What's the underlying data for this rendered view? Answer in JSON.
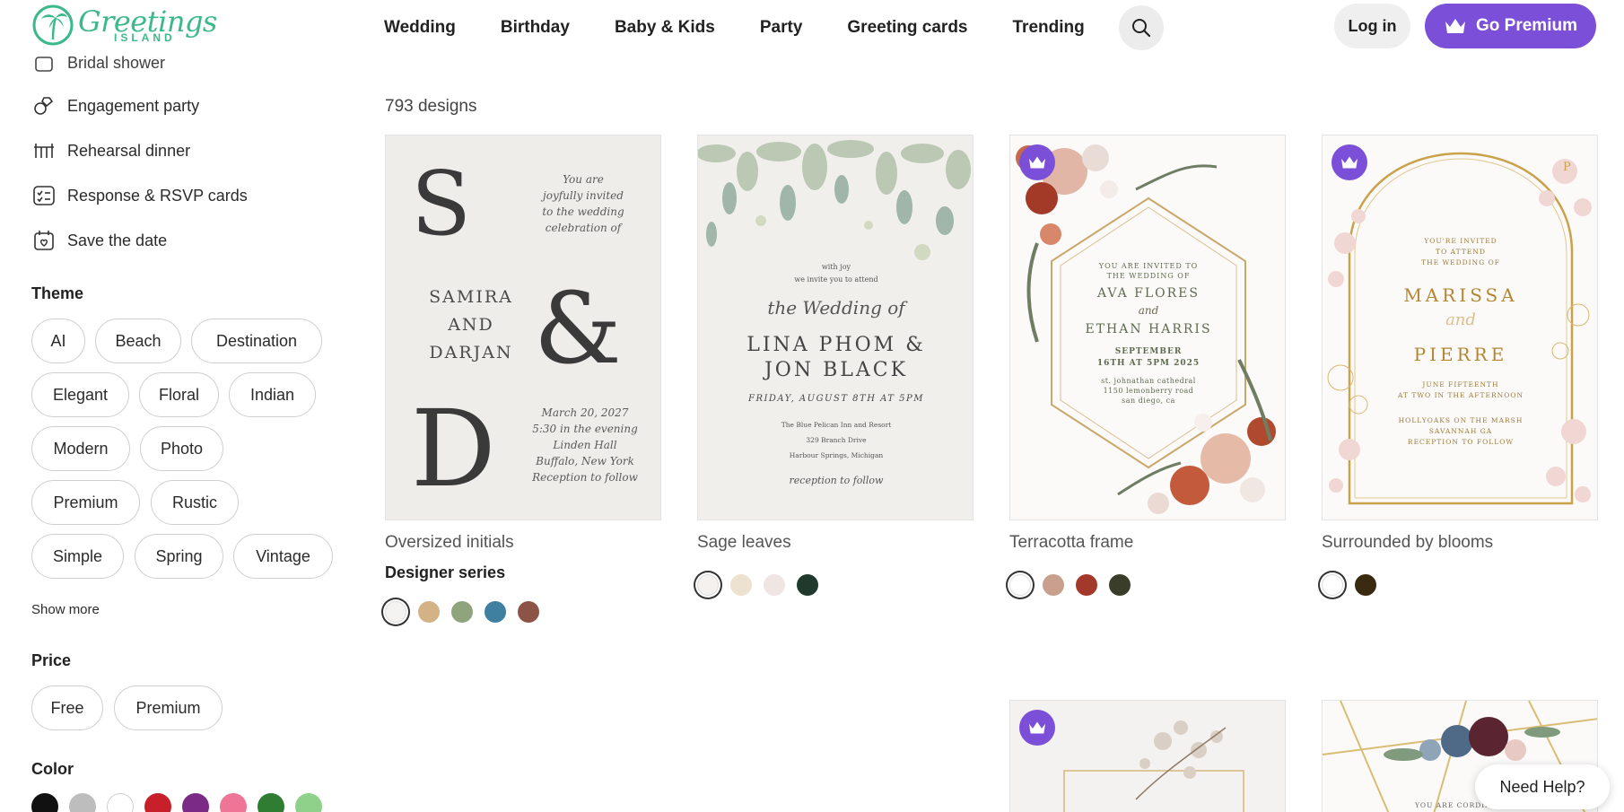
{
  "header": {
    "logo_main": "Greetings",
    "logo_sub": "ISLAND",
    "nav": [
      "Wedding",
      "Birthday",
      "Baby & Kids",
      "Party",
      "Greeting cards",
      "Trending"
    ],
    "login": "Log in",
    "premium": "Go Premium"
  },
  "sidebar": {
    "partial_link": "Bridal shower",
    "links": [
      "Engagement party",
      "Rehearsal dinner",
      "Response & RSVP cards",
      "Save the date"
    ],
    "theme_title": "Theme",
    "themes": [
      "AI",
      "Beach",
      "Destination",
      "Elegant",
      "Floral",
      "Indian",
      "Modern",
      "Photo",
      "Premium",
      "Rustic",
      "Simple",
      "Spring",
      "Vintage"
    ],
    "show_more": "Show more",
    "price_title": "Price",
    "prices": [
      "Free",
      "Premium"
    ],
    "color_title": "Color",
    "colors": [
      "#111111",
      "#bdbdbd",
      "#ffffff",
      "#c8202b",
      "#7b2a85",
      "#ef7597",
      "#2e7d32",
      "#8fd18a"
    ]
  },
  "main": {
    "count": "793 designs",
    "cards": [
      {
        "title": "Oversized initials",
        "subtitle": "Designer series",
        "premium": false,
        "colors": [
          "#f5f3f2",
          "#d3b286",
          "#8fa37d",
          "#3f7f9f",
          "#8b5447"
        ],
        "invite": {
          "initial1": "S",
          "amp": "&",
          "initial2": "D",
          "intro": [
            "You are",
            "joyfully invited",
            "to the wedding",
            "celebration of"
          ],
          "names": [
            "SAMIRA",
            "AND",
            "DARJAN"
          ],
          "details": [
            "March 20, 2027",
            "5:30 in the evening",
            "Linden Hall",
            "Buffalo, New York",
            "Reception to follow"
          ]
        }
      },
      {
        "title": "Sage leaves",
        "premium": false,
        "colors": [
          "#f5f1ef",
          "#ede1cf",
          "#efe5e2",
          "#1f3a2c"
        ],
        "invite": {
          "lines": [
            "with joy",
            "we invite you to attend"
          ],
          "script": "the Wedding of",
          "names": [
            "LINA PHOM &",
            "JON BLACK"
          ],
          "date": "FRIDAY, AUGUST 8TH AT 5PM",
          "venue": [
            "The Blue Pelican Inn and Resort",
            "329 Branch Drive",
            "Harbour Springs, Michigan"
          ],
          "footer": "reception to follow"
        }
      },
      {
        "title": "Terracotta frame",
        "premium": true,
        "colors": [
          "#ffffff",
          "#c9a08e",
          "#a3392a",
          "#3a3d2a"
        ],
        "invite": {
          "lines": [
            "YOU ARE INVITED TO",
            "THE WEDDING OF"
          ],
          "name1": "AVA FLORES",
          "and": "and",
          "name2": "ETHAN HARRIS",
          "date": [
            "SEPTEMBER",
            "16TH AT 5PM 2025"
          ],
          "venue": [
            "st. johnathan cathedral",
            "1150 lemonberry road",
            "san diego, ca"
          ]
        }
      },
      {
        "title": "Surrounded by blooms",
        "premium": true,
        "colors": [
          "#ffffff",
          "#3b2a12"
        ],
        "invite": {
          "corner": "P",
          "lines": [
            "YOU'RE INVITED",
            "TO ATTEND",
            "THE WEDDING OF"
          ],
          "name1": "MARISSA",
          "and": "and",
          "name2": "PIERRE",
          "date": [
            "JUNE FIFTEENTH",
            "AT TWO IN THE AFTERNOON"
          ],
          "venue": [
            "HOLLYOAKS ON THE MARSH",
            "SAVANNAH GA",
            "RECEPTION TO FOLLOW"
          ]
        }
      },
      {
        "premium": true
      },
      {
        "premium": false,
        "invite": {
          "line": "YOU ARE CORDIALLY"
        }
      }
    ]
  },
  "help": "Need Help?",
  "accent": "#7c4fd8",
  "brand": "#3cb98a"
}
